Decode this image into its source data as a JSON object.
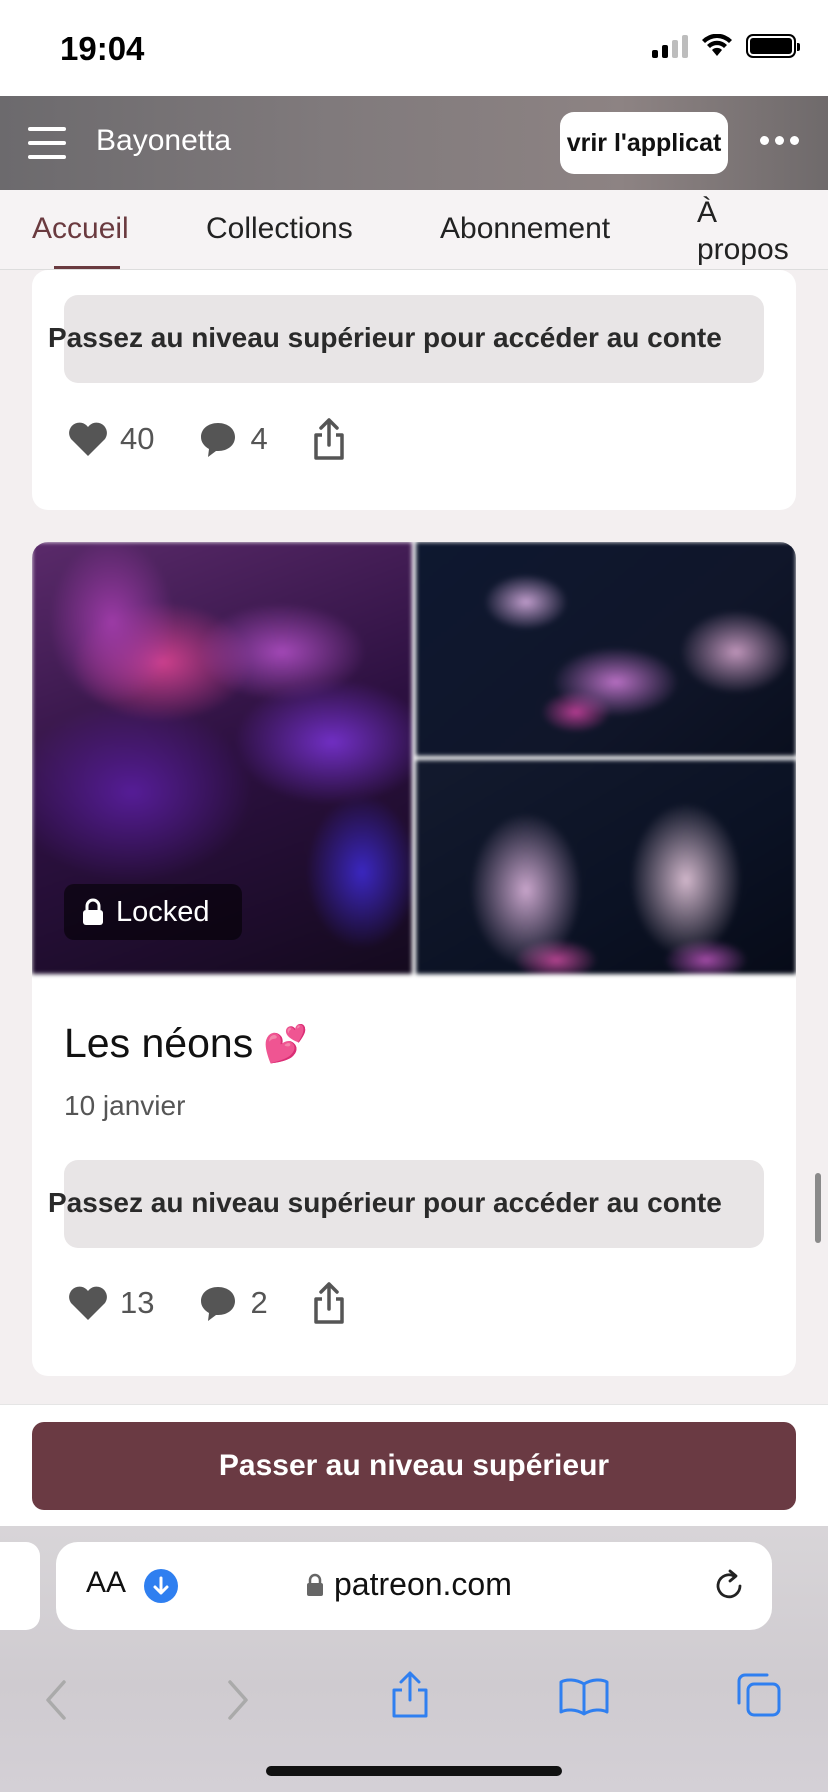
{
  "status_bar": {
    "time": "19:04"
  },
  "header": {
    "creator_name": "Bayonetta",
    "open_app_label": "vrir l'applicat"
  },
  "tabs": [
    {
      "label": "Accueil",
      "active": true
    },
    {
      "label": "Collections",
      "active": false
    },
    {
      "label": "Abonnement",
      "active": false
    },
    {
      "label": "À propos",
      "active": false
    }
  ],
  "posts": [
    {
      "upgrade_prompt": "Passez au niveau supérieur pour accéder au conte",
      "likes": "40",
      "comments": "4"
    },
    {
      "locked_label": "Locked",
      "title": "Les néons",
      "title_emoji": "💕",
      "date": "10 janvier",
      "upgrade_prompt": "Passez au niveau supérieur pour accéder au conte",
      "likes": "13",
      "comments": "2"
    }
  ],
  "upgrade_button_label": "Passer au niveau supérieur",
  "browser": {
    "aa_label": "AA",
    "url": "patreon.com"
  },
  "colors": {
    "accent": "#6a3a43",
    "tab_active": "#6a3a3f",
    "safari_blue": "#2f7ff0"
  }
}
